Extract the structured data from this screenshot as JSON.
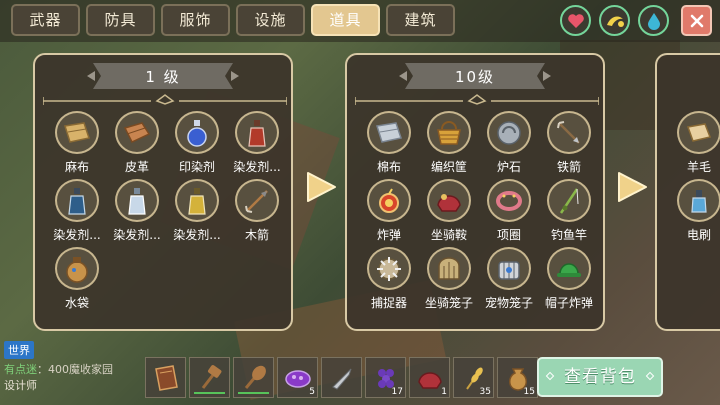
{
  "tabs": [
    {
      "label": "武器",
      "active": false
    },
    {
      "label": "防具",
      "active": false
    },
    {
      "label": "服饰",
      "active": false
    },
    {
      "label": "设施",
      "active": false
    },
    {
      "label": "道具",
      "active": true
    },
    {
      "label": "建筑",
      "active": false
    }
  ],
  "top_icons": [
    "heart-icon",
    "food-icon",
    "water-drop-icon",
    "close-icon"
  ],
  "panels": [
    {
      "title": "1  级",
      "items": [
        {
          "label": "麻布",
          "icon": "linen-cloth-icon"
        },
        {
          "label": "皮革",
          "icon": "leather-icon"
        },
        {
          "label": "印染剂",
          "icon": "dye-potion-icon"
        },
        {
          "label": "染发剂...",
          "icon": "hair-dye-red-icon"
        },
        {
          "label": "染发剂...",
          "icon": "hair-dye-blue-icon"
        },
        {
          "label": "染发剂...",
          "icon": "hair-dye-white-icon"
        },
        {
          "label": "染发剂...",
          "icon": "hair-dye-yellow-icon"
        },
        {
          "label": "木箭",
          "icon": "wooden-arrow-icon"
        },
        {
          "label": "水袋",
          "icon": "water-bag-icon"
        }
      ]
    },
    {
      "title": "10级",
      "items": [
        {
          "label": "棉布",
          "icon": "cotton-cloth-icon"
        },
        {
          "label": "编织筐",
          "icon": "woven-basket-icon"
        },
        {
          "label": "炉石",
          "icon": "hearthstone-icon"
        },
        {
          "label": "铁箭",
          "icon": "iron-arrow-icon"
        },
        {
          "label": "炸弹",
          "icon": "bomb-icon"
        },
        {
          "label": "坐骑鞍",
          "icon": "saddle-icon"
        },
        {
          "label": "项圈",
          "icon": "collar-icon"
        },
        {
          "label": "钓鱼竿",
          "icon": "fishing-rod-icon"
        },
        {
          "label": "捕捉器",
          "icon": "trap-icon"
        },
        {
          "label": "坐骑笼子",
          "icon": "mount-cage-icon"
        },
        {
          "label": "宠物笼子",
          "icon": "pet-cage-icon"
        },
        {
          "label": "帽子炸弹",
          "icon": "hat-bomb-icon"
        }
      ]
    },
    {
      "title": "",
      "items": [
        {
          "label": "羊毛",
          "icon": "wool-icon"
        },
        {
          "label": "电刷",
          "icon": "brush-icon"
        }
      ]
    }
  ],
  "chat": {
    "channel": "世界",
    "sender": "有点迷",
    "message": "：400魔收家园",
    "line2": "设计师"
  },
  "hotbar": [
    {
      "icon": "book-icon",
      "count": "",
      "durability": false
    },
    {
      "icon": "hammer-icon",
      "count": "",
      "durability": true
    },
    {
      "icon": "club-icon",
      "count": "",
      "durability": true
    },
    {
      "icon": "berry-bowl-icon",
      "count": "5",
      "durability": false
    },
    {
      "icon": "knife-icon",
      "count": "",
      "durability": false
    },
    {
      "icon": "grapes-icon",
      "count": "17",
      "durability": false
    },
    {
      "icon": "saddle-icon",
      "count": "1",
      "durability": false
    },
    {
      "icon": "wheat-icon",
      "count": "35",
      "durability": false
    },
    {
      "icon": "sack-icon",
      "count": "15",
      "durability": false
    }
  ],
  "bag_button": "查看背包",
  "colors": {
    "panel_border": "#d8c9a5",
    "tab_active": "#e3c790",
    "stat_ring": "#74d59a",
    "bag_button": "#9ad6b3",
    "close_button": "#e07a6a"
  }
}
